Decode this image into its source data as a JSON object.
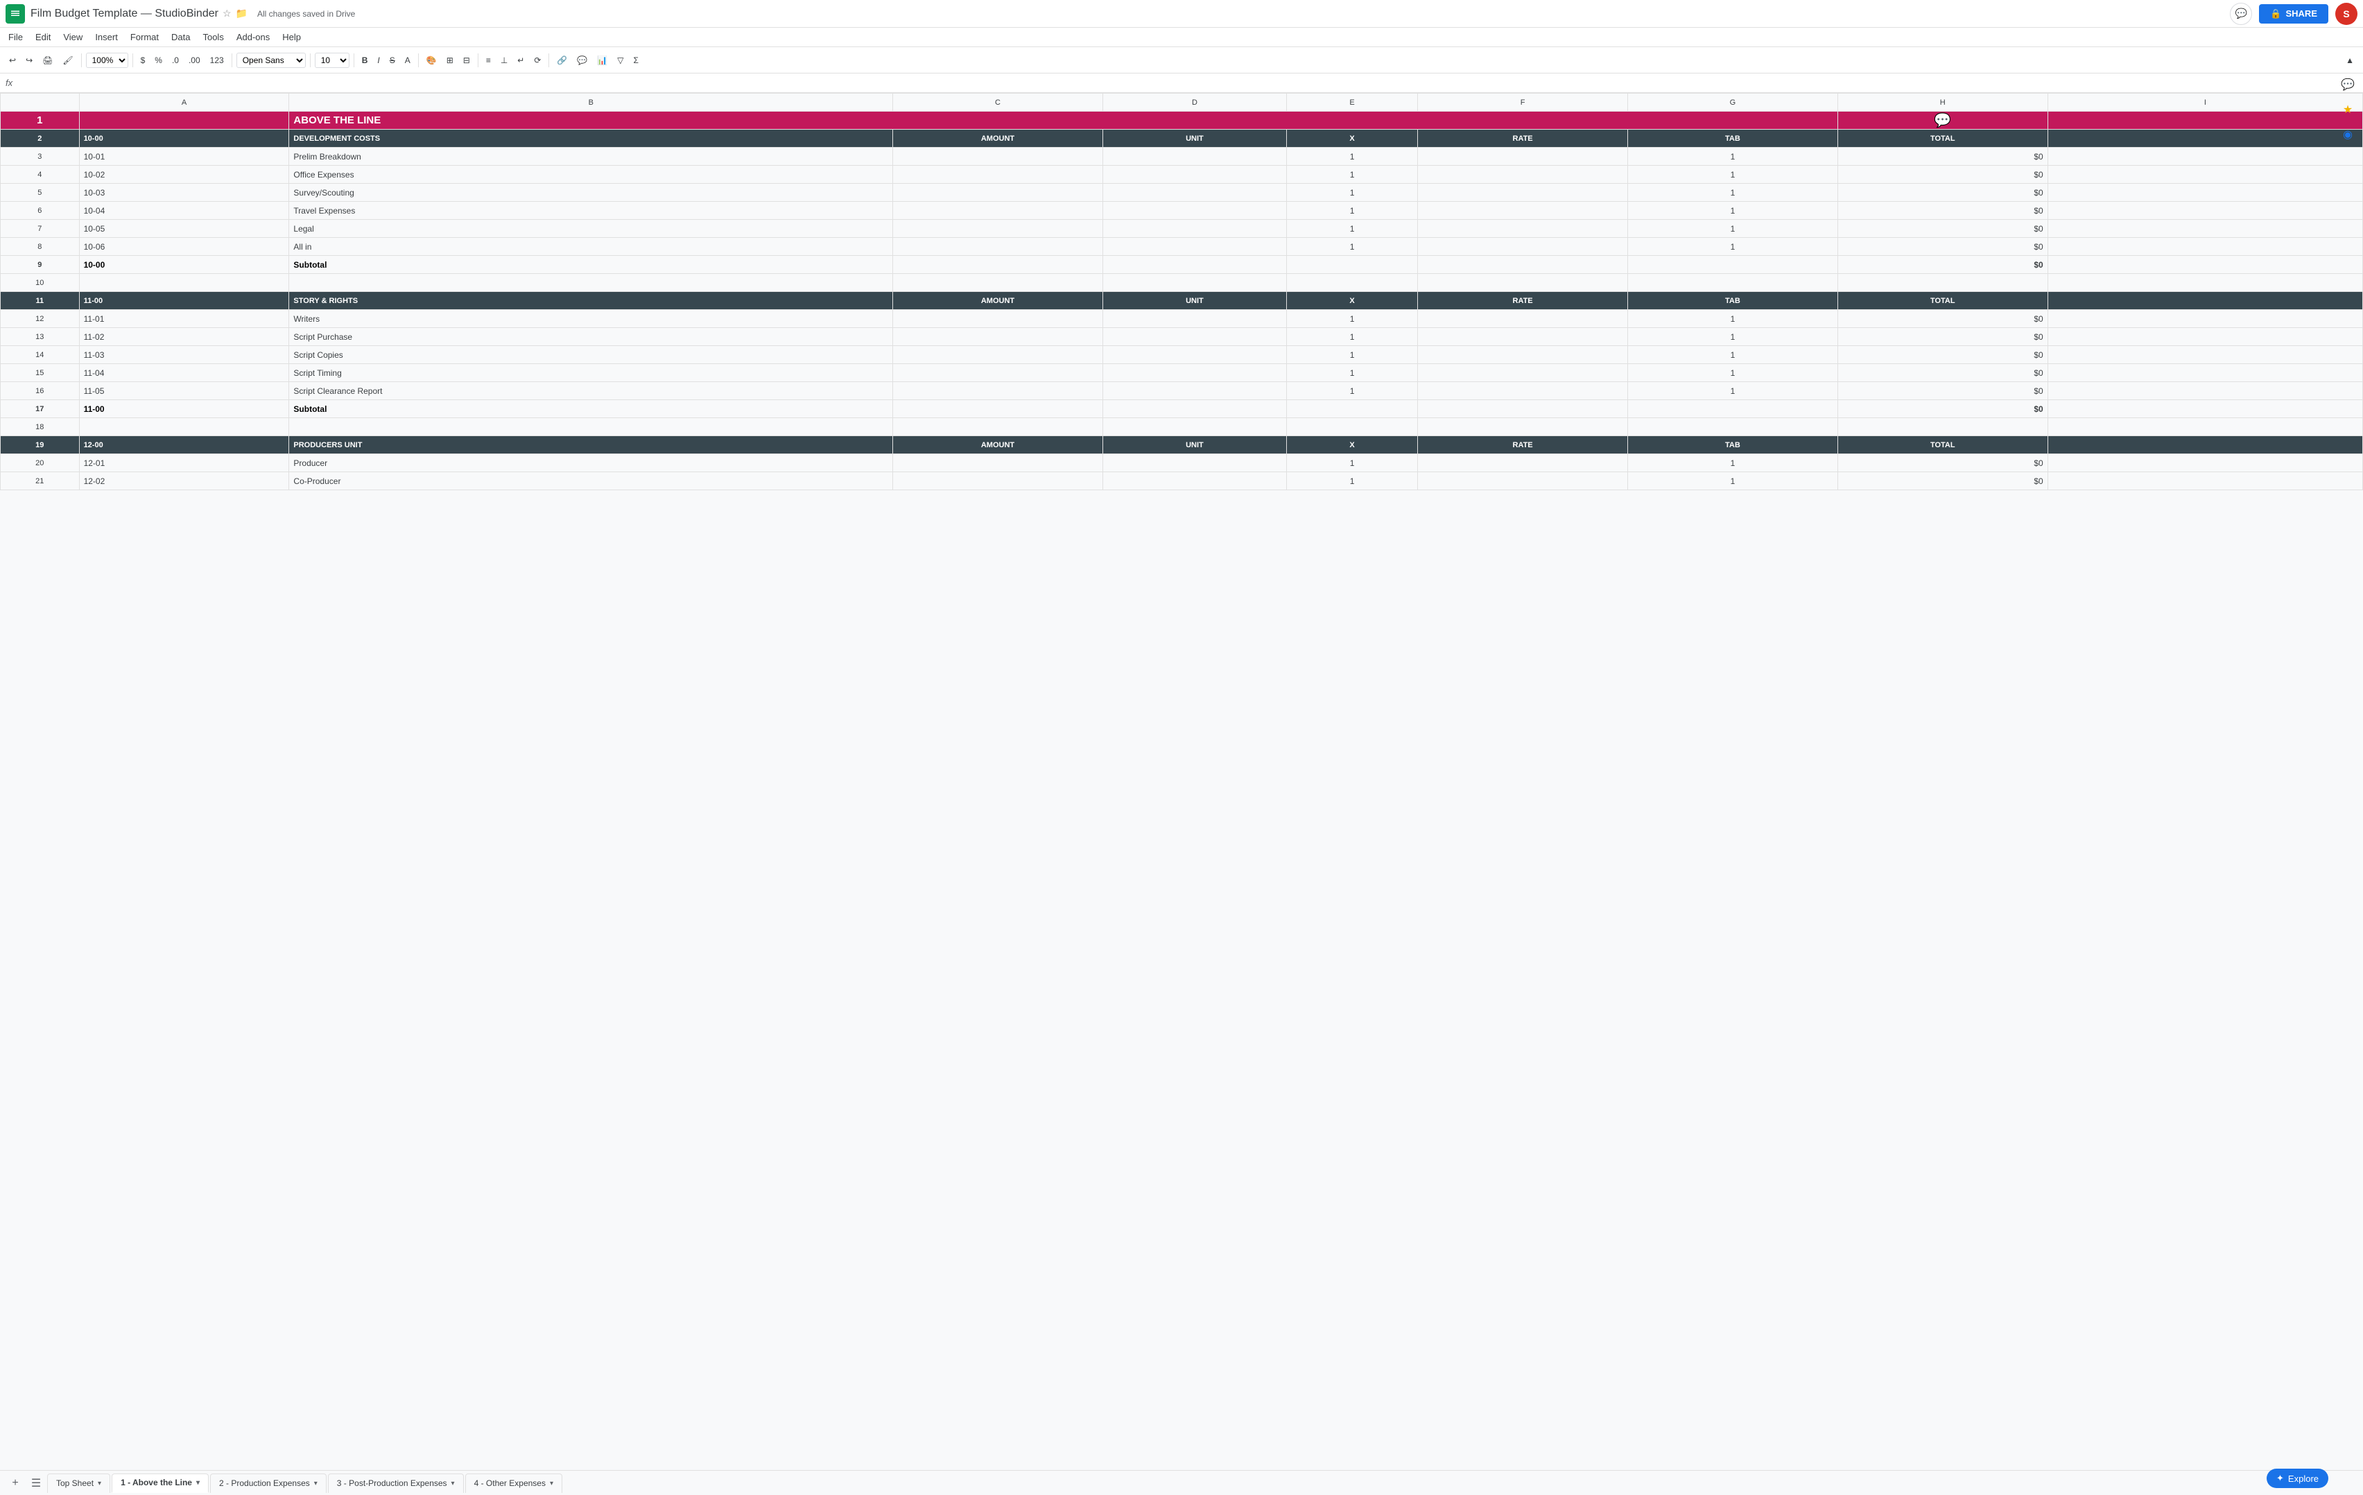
{
  "app": {
    "icon": "G",
    "title": "Film Budget Template — StudioBinder",
    "save_status": "All changes saved in Drive",
    "share_label": "SHARE",
    "avatar_letter": "S"
  },
  "menu": {
    "items": [
      "File",
      "Edit",
      "View",
      "Insert",
      "Format",
      "Data",
      "Tools",
      "Add-ons",
      "Help"
    ]
  },
  "toolbar": {
    "zoom": "100%",
    "font": "Open Sans",
    "font_size": "10",
    "currency": "$",
    "percent": "%",
    "decimal_dec": ".0",
    "decimal_inc": ".00",
    "format_num": "123"
  },
  "formula_bar": {
    "icon": "fx"
  },
  "spreadsheet": {
    "columns": [
      "",
      "A",
      "B",
      "C",
      "D",
      "E",
      "F",
      "G",
      "H",
      "I"
    ],
    "header_title": "ABOVE THE LINE",
    "sections": [
      {
        "code": "10-00",
        "label": "DEVELOPMENT COSTS",
        "type": "section_header",
        "cols": [
          "AMOUNT",
          "UNIT",
          "X",
          "RATE",
          "TAB",
          "TOTAL"
        ]
      },
      {
        "code": "10-01",
        "label": "Prelim Breakdown",
        "type": "data",
        "amount": "",
        "unit": "",
        "x": "1",
        "rate": "",
        "tab": "1",
        "total": "$0"
      },
      {
        "code": "10-02",
        "label": "Office Expenses",
        "type": "data",
        "amount": "",
        "unit": "",
        "x": "1",
        "rate": "",
        "tab": "1",
        "total": "$0"
      },
      {
        "code": "10-03",
        "label": "Survey/Scouting",
        "type": "data",
        "amount": "",
        "unit": "",
        "x": "1",
        "rate": "",
        "tab": "1",
        "total": "$0"
      },
      {
        "code": "10-04",
        "label": "Travel Expenses",
        "type": "data",
        "amount": "",
        "unit": "",
        "x": "1",
        "rate": "",
        "tab": "1",
        "total": "$0"
      },
      {
        "code": "10-05",
        "label": "Legal",
        "type": "data",
        "amount": "",
        "unit": "",
        "x": "1",
        "rate": "",
        "tab": "1",
        "total": "$0"
      },
      {
        "code": "10-06",
        "label": "All in",
        "type": "data",
        "amount": "",
        "unit": "",
        "x": "1",
        "rate": "",
        "tab": "1",
        "total": "$0"
      },
      {
        "code": "10-00",
        "label": "Subtotal",
        "type": "subtotal",
        "total": "$0"
      },
      {
        "code": "",
        "label": "",
        "type": "empty"
      },
      {
        "code": "11-00",
        "label": "STORY & RIGHTS",
        "type": "section_header",
        "cols": [
          "AMOUNT",
          "UNIT",
          "X",
          "RATE",
          "TAB",
          "TOTAL"
        ]
      },
      {
        "code": "11-01",
        "label": "Writers",
        "type": "data",
        "amount": "",
        "unit": "",
        "x": "1",
        "rate": "",
        "tab": "1",
        "total": "$0"
      },
      {
        "code": "11-02",
        "label": "Script Purchase",
        "type": "data",
        "amount": "",
        "unit": "",
        "x": "1",
        "rate": "",
        "tab": "1",
        "total": "$0"
      },
      {
        "code": "11-03",
        "label": "Script Copies",
        "type": "data",
        "amount": "",
        "unit": "",
        "x": "1",
        "rate": "",
        "tab": "1",
        "total": "$0"
      },
      {
        "code": "11-04",
        "label": "Script Timing",
        "type": "data",
        "amount": "",
        "unit": "",
        "x": "1",
        "rate": "",
        "tab": "1",
        "total": "$0"
      },
      {
        "code": "11-05",
        "label": "Script Clearance Report",
        "type": "data",
        "amount": "",
        "unit": "",
        "x": "1",
        "rate": "",
        "tab": "1",
        "total": "$0"
      },
      {
        "code": "11-00",
        "label": "Subtotal",
        "type": "subtotal",
        "total": "$0"
      },
      {
        "code": "",
        "label": "",
        "type": "empty"
      },
      {
        "code": "12-00",
        "label": "PRODUCERS UNIT",
        "type": "section_header",
        "cols": [
          "AMOUNT",
          "UNIT",
          "X",
          "RATE",
          "TAB",
          "TOTAL"
        ]
      },
      {
        "code": "12-01",
        "label": "Producer",
        "type": "data",
        "amount": "",
        "unit": "",
        "x": "1",
        "rate": "",
        "tab": "1",
        "total": "$0"
      },
      {
        "code": "12-02",
        "label": "Co-Producer",
        "type": "data",
        "amount": "",
        "unit": "",
        "x": "1",
        "rate": "",
        "tab": "1",
        "total": "$0"
      }
    ]
  },
  "tabs": {
    "items": [
      {
        "label": "Top Sheet",
        "active": false
      },
      {
        "label": "1 - Above the Line",
        "active": true
      },
      {
        "label": "2 - Production Expenses",
        "active": false
      },
      {
        "label": "3 - Post-Production Expenses",
        "active": false
      },
      {
        "label": "4 - Other Expenses",
        "active": false
      }
    ]
  },
  "explore": {
    "label": "Explore"
  },
  "colors": {
    "header_bg": "#c2185b",
    "section_bg": "#37474f",
    "section_text": "#ffffff",
    "share_btn": "#1a73e8"
  }
}
